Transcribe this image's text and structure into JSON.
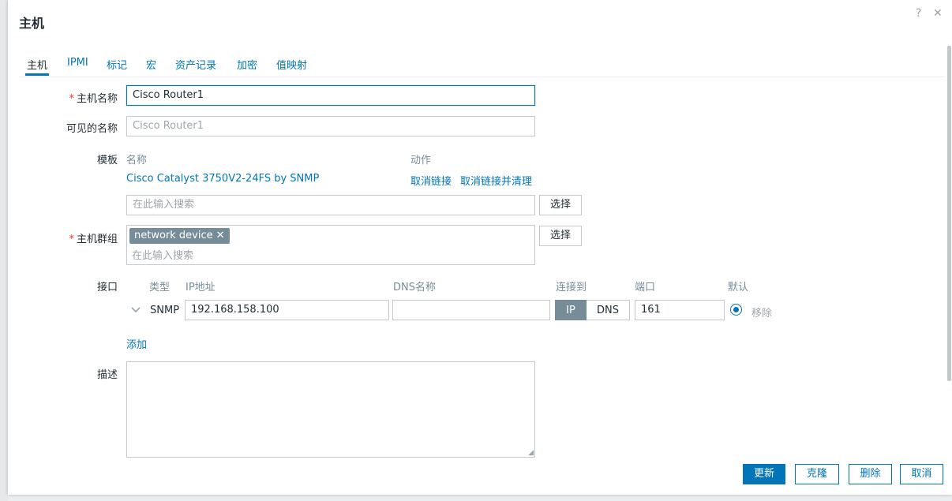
{
  "dialog": {
    "title": "主机",
    "help_icon": "?",
    "close_icon": "✕"
  },
  "tabs": [
    {
      "label": "主机",
      "active": true
    },
    {
      "label": "IPMI"
    },
    {
      "label": "标记"
    },
    {
      "label": "宏"
    },
    {
      "label": "资产记录"
    },
    {
      "label": "加密"
    },
    {
      "label": "值映射"
    }
  ],
  "form": {
    "required_mark": "*",
    "host_name": {
      "label": "主机名称",
      "value": "Cisco Router1"
    },
    "visible_name": {
      "label": "可见的名称",
      "placeholder": "Cisco Router1"
    },
    "templates": {
      "label": "模板",
      "col_name": "名称",
      "col_action": "动作",
      "linked": {
        "name": "Cisco Catalyst 3750V2-24FS by SNMP",
        "unlink": "取消链接",
        "unlink_clear": "取消链接并清理"
      },
      "search_placeholder": "在此输入搜索",
      "select_button": "选择"
    },
    "host_groups": {
      "label": "主机群组",
      "chip": "network device",
      "chip_remove": "✕",
      "search_placeholder": "在此输入搜索",
      "select_button": "选择"
    },
    "interfaces": {
      "label": "接口",
      "headers": {
        "type": "类型",
        "ip": "IP地址",
        "dns": "DNS名称",
        "connect": "连接到",
        "port": "端口",
        "default": "默认"
      },
      "row": {
        "type": "SNMP",
        "ip": "192.168.158.100",
        "dns": "",
        "connect_ip": "IP",
        "connect_dns": "DNS",
        "connect_selected": "IP",
        "port": "161",
        "remove": "移除"
      },
      "add": "添加"
    },
    "description": {
      "label": "描述",
      "value": ""
    }
  },
  "footer": {
    "update": "更新",
    "clone": "克隆",
    "delete": "删除",
    "cancel": "取消"
  },
  "colors": {
    "accent": "#0275b8",
    "required": "#e33734",
    "chip": "#768d99"
  }
}
